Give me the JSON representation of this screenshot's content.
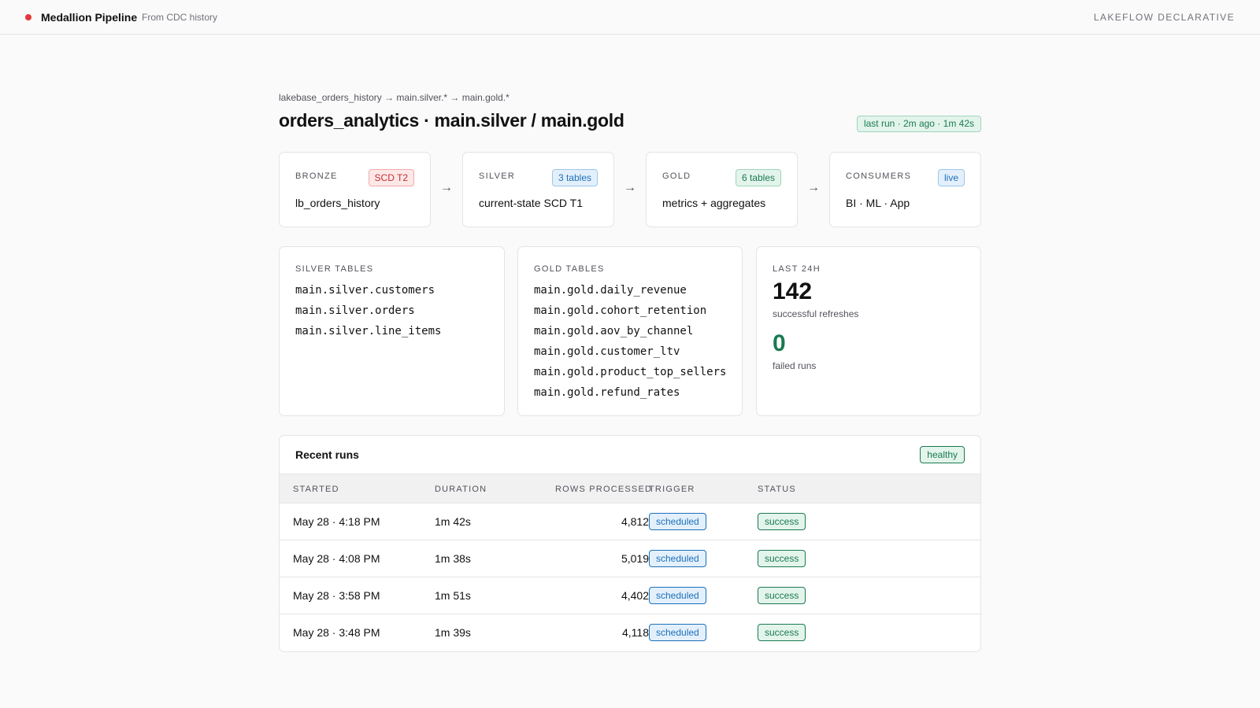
{
  "header": {
    "title": "Medallion Pipeline",
    "subtitle": "From CDC history",
    "brand": "LAKEFLOW DECLARATIVE",
    "status_color": "#e5383b"
  },
  "breadcrumb": "lakebase_orders_history → main.silver.* → main.gold.*",
  "page_title": "orders_analytics · main.silver / main.gold",
  "last_run": "last run · 2m ago · 1m 42s",
  "flow_arrow": "→",
  "stages": [
    {
      "label": "BRONZE",
      "badge": "SCD T2",
      "badge_color": "red",
      "value": "lb_orders_history"
    },
    {
      "label": "SILVER",
      "badge": "3 tables",
      "badge_color": "blue",
      "value": "current-state SCD T1"
    },
    {
      "label": "GOLD",
      "badge": "6 tables",
      "badge_color": "green",
      "value": "metrics + aggregates"
    },
    {
      "label": "CONSUMERS",
      "badge": "live",
      "badge_color": "blue",
      "value": "BI · ML · App"
    }
  ],
  "silver_tables": {
    "label": "SILVER TABLES",
    "items": [
      "main.silver.customers",
      "main.silver.orders",
      "main.silver.line_items"
    ]
  },
  "gold_tables": {
    "label": "GOLD TABLES",
    "items": [
      "main.gold.daily_revenue",
      "main.gold.cohort_retention",
      "main.gold.aov_by_channel",
      "main.gold.customer_ltv",
      "main.gold.product_top_sellers",
      "main.gold.refund_rates"
    ]
  },
  "stats": {
    "label": "LAST 24H",
    "success_count": "142",
    "success_label": "successful refreshes",
    "failed_count": "0",
    "failed_label": "failed runs",
    "failed_color": "#1a7a52"
  },
  "runs": {
    "title": "Recent runs",
    "health": "healthy",
    "columns": [
      "STARTED",
      "DURATION",
      "ROWS PROCESSED",
      "TRIGGER",
      "STATUS"
    ],
    "rows": [
      {
        "started": "May 28 · 4:18 PM",
        "duration": "1m 42s",
        "rows": "4,812",
        "trigger": "scheduled",
        "status": "success"
      },
      {
        "started": "May 28 · 4:08 PM",
        "duration": "1m 38s",
        "rows": "5,019",
        "trigger": "scheduled",
        "status": "success"
      },
      {
        "started": "May 28 · 3:58 PM",
        "duration": "1m 51s",
        "rows": "4,402",
        "trigger": "scheduled",
        "status": "success"
      },
      {
        "started": "May 28 · 3:48 PM",
        "duration": "1m 39s",
        "rows": "4,118",
        "trigger": "scheduled",
        "status": "success"
      }
    ]
  }
}
